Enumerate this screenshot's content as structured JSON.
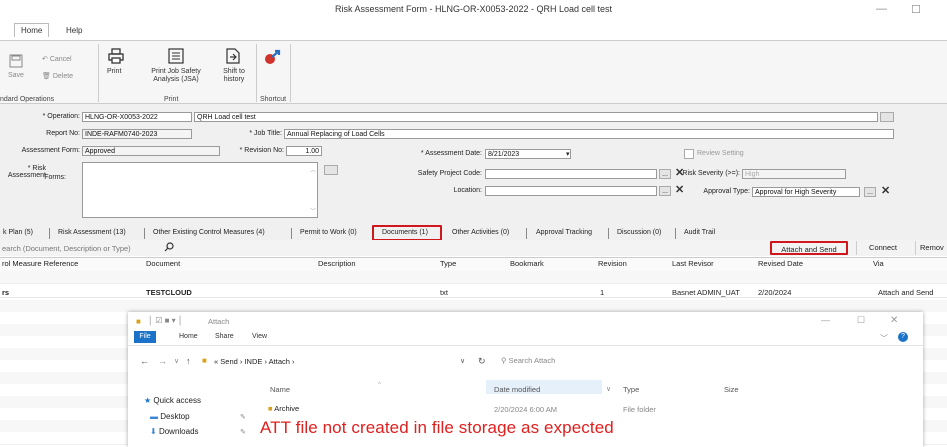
{
  "window": {
    "title": "Risk Assessment Form - HLNG-OR-X0053-2022 - QRH Load cell test"
  },
  "ribbon": {
    "tabs": [
      "Home",
      "Help"
    ],
    "save": "Save",
    "cancel": "Cancel",
    "delete": "Delete",
    "print": "Print",
    "print_jsa_l1": "Print Job Safety",
    "print_jsa_l2": "Analysis (JSA)",
    "shift_l1": "Shift to",
    "shift_l2": "history",
    "groups": [
      "ndard Operations",
      "Print",
      "Shortcut"
    ]
  },
  "form": {
    "operation_label": "* Operation:",
    "operation_value": "HLNG-OR-X0053-2022",
    "operation_name": "QRH Load cell test",
    "report_label": "Report No:",
    "report_value": "INDE-RAFM0740-2023",
    "job_title_label": "* Job Title:",
    "job_title_value": "Annual Replacing of Load Cells",
    "assess_form_label": "Assessment Form:",
    "assess_form_value": "Approved",
    "revision_label": "* Revision No:",
    "revision_value": "1.00",
    "assess_date_label": "* Assessment Date:",
    "assess_date_value": "8/21/2023",
    "review_setting": "Review Setting",
    "risk_forms_l1": "* Risk Assessment",
    "risk_forms_l2": "Forms:",
    "safety_code_label": "Safety Project Code:",
    "location_label": "Location:",
    "risk_severity_label": "Risk Severity (>=):",
    "risk_severity_value": "High",
    "approval_type_label": "Approval Type:",
    "approval_type_value": "Approval for High Severity",
    "ellipsis": "...",
    "x": "✕"
  },
  "tabs": [
    "k Plan (5)",
    "Risk Assessment (13)",
    "Other Existing Control Measures (4)",
    "Permit to Work (0)",
    "Documents (1)",
    "Other Activities (0)",
    "Approval Tracking",
    "Discussion (0)",
    "Audit Trail"
  ],
  "toolbar": {
    "search_placeholder": "earch (Document, Description or Type)",
    "attach_send": "Attach and Send",
    "connect": "Connect",
    "remove": "Remov"
  },
  "grid": {
    "headers": [
      "rol Measure Reference",
      "Document",
      "Description",
      "Type",
      "Bookmark",
      "Revision",
      "Last Revisor",
      "Revised Date",
      "Via"
    ],
    "row": {
      "ref": "rs",
      "document": "TESTCLOUD",
      "type": "txt",
      "revision": "1",
      "revisor": "Basnet ADMIN_UAT",
      "date": "2/20/2024",
      "via": "Attach and Send"
    }
  },
  "explorer": {
    "title": "Attach",
    "tabs": [
      "File",
      "Home",
      "Share",
      "View"
    ],
    "path": [
      "Send",
      "INDE",
      "Attach"
    ],
    "search": "Search Attach",
    "columns": [
      "Name",
      "Date modified",
      "Type",
      "Size"
    ],
    "nav": [
      "Quick access",
      "Desktop",
      "Downloads"
    ],
    "item": {
      "name": "Archive",
      "date": "2/20/2024 6:00 AM",
      "type": "File folder"
    }
  },
  "annotation": "ATT file not created in file storage as expected"
}
